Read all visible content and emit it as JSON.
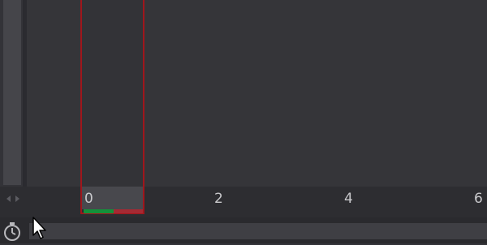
{
  "timeline": {
    "ticks": [
      "0",
      "2",
      "4",
      "6"
    ],
    "range": {
      "start": 0,
      "end": 1
    },
    "colors": {
      "background": "#353539",
      "range_border": "#a0161c",
      "marker_green": "#14913a",
      "marker_red": "#a52a33"
    }
  },
  "icons": {
    "resize": "resize-horizontal-icon",
    "clock": "stopwatch-icon",
    "cursor": "mouse-pointer-icon"
  }
}
